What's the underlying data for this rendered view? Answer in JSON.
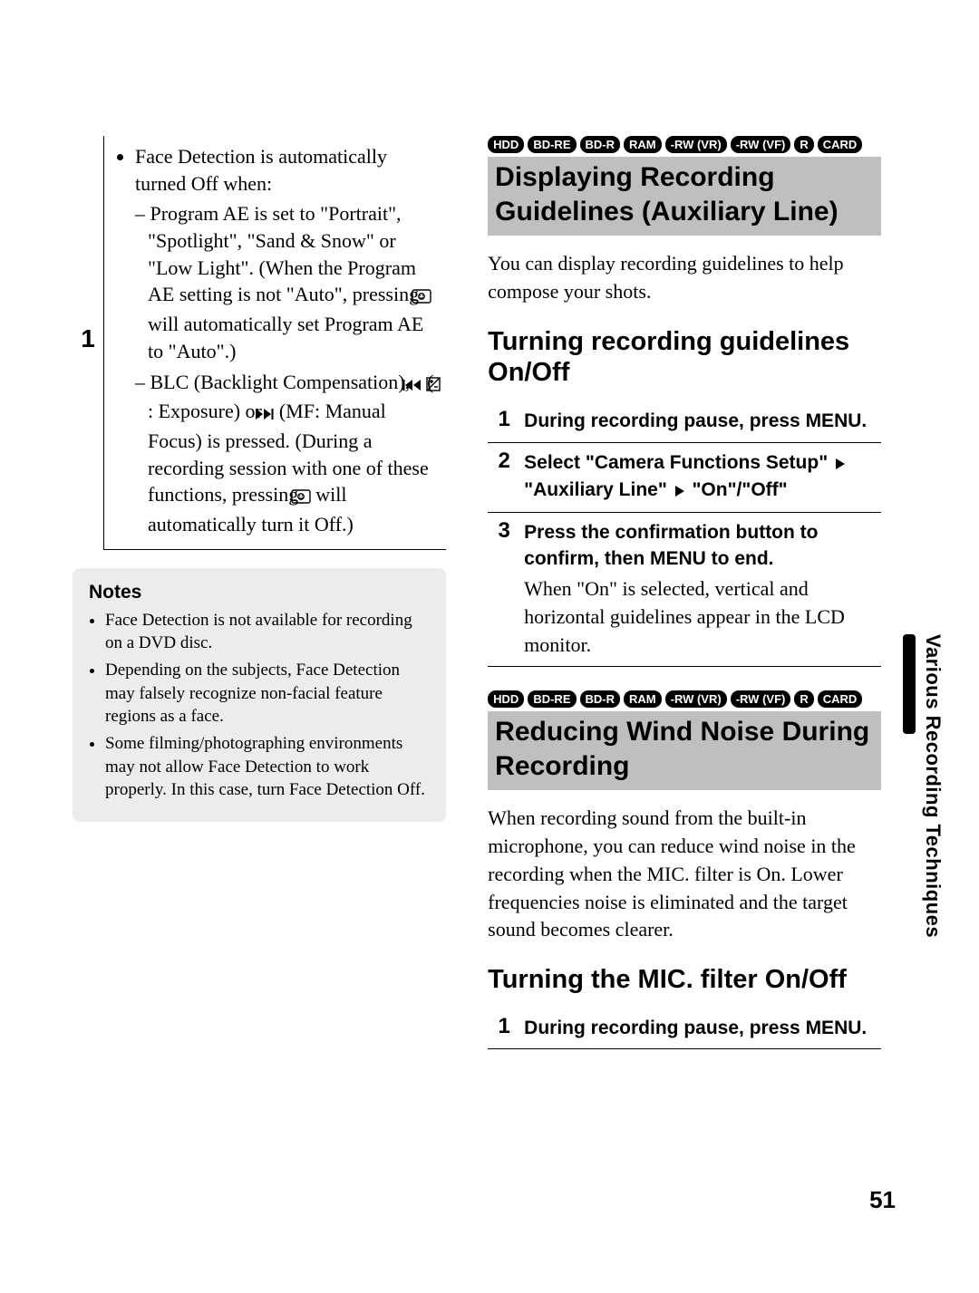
{
  "page_number": "51",
  "side_tab": "Various Recording Techniques",
  "left": {
    "step_number": "1",
    "bullet_lead": "Face Detection is automatically turned Off when:",
    "sub1_a": "– Program AE is set to \"Portrait\", \"Spotlight\", \"Sand & Snow\" or \"Low Light\". (When the Program AE setting is not \"Auto\", pressing ",
    "sub1_b": " will automatically set Program AE to \"Auto\".)",
    "sub2_a": "– BLC (Backlight Compensation), ",
    "sub2_b": " (",
    "sub2_c": ": Exposure) or ",
    "sub2_d": " (MF: Manual Focus) is pressed. (During a recording session with one of these functions, pressing ",
    "sub2_e": " will automatically turn it Off.)",
    "notes_title": "Notes",
    "notes": [
      "Face Detection is not available for recording on a DVD disc.",
      "Depending on the subjects, Face Detection may falsely recognize non-facial feature regions as a face.",
      "Some filming/photographing environments may not allow Face Detection to work properly. In this case, turn Face Detection Off."
    ]
  },
  "right": {
    "badges": [
      "HDD",
      "BD-RE",
      "BD-R",
      "RAM",
      "-RW (VR)",
      "-RW (VF)",
      "R",
      "CARD"
    ],
    "section1_title": "Displaying Recording Guidelines (Auxiliary Line)",
    "section1_body": "You can display recording guidelines to help compose your shots.",
    "sub1_title": "Turning recording guidelines On/Off",
    "sub1_steps": [
      {
        "n": "1",
        "bold": "During recording pause, press MENU."
      },
      {
        "n": "2",
        "bold_parts": [
          "Select \"Camera Functions Setup\" ",
          " \"Auxiliary Line\" ",
          " \"On\"/\"Off\""
        ]
      },
      {
        "n": "3",
        "bold": "Press the confirmation button to confirm, then MENU to end.",
        "plain": "When \"On\" is selected, vertical and horizontal guidelines appear in the LCD monitor."
      }
    ],
    "section2_title": "Reducing Wind Noise During Recording",
    "section2_body": "When recording sound from the built-in microphone, you can reduce wind noise in the recording when the MIC. filter is On. Lower frequencies noise is eliminated and the target sound becomes clearer.",
    "sub2_title": "Turning the MIC. filter On/Off",
    "sub2_steps": [
      {
        "n": "1",
        "bold": "During recording pause, press MENU."
      }
    ]
  }
}
